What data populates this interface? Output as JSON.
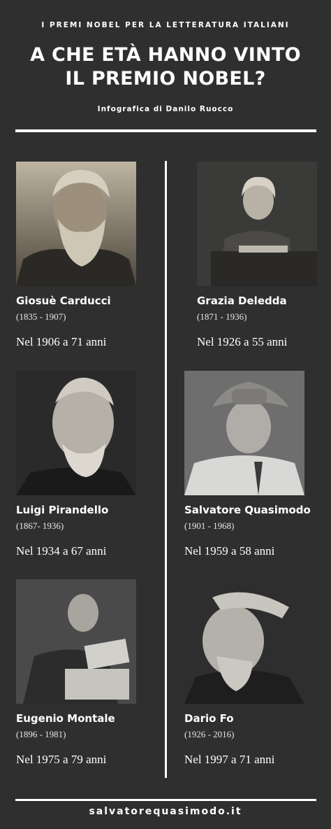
{
  "header": {
    "kicker": "I PREMI NOBEL PER LA LETTERATURA ITALIANI",
    "title_line1": "A CHE ETÀ HANNO VINTO",
    "title_line2": "IL PREMIO NOBEL?",
    "byline": "Infografica di Danilo Ruocco"
  },
  "laureates": [
    {
      "name": "Giosuè Carducci",
      "dates": "(1835 - 1907)",
      "prize": "Nel 1906 a 71 anni"
    },
    {
      "name": "Grazia Deledda",
      "dates": "(1871 - 1936)",
      "prize": "Nel 1926 a 55 anni"
    },
    {
      "name": "Luigi Pirandello",
      "dates": "(1867- 1936)",
      "prize": "Nel 1934 a 67 anni"
    },
    {
      "name": "Salvatore Quasimodo",
      "dates": "(1901 - 1968)",
      "prize": "Nel 1959 a 58 anni"
    },
    {
      "name": "Eugenio Montale",
      "dates": "(1896 - 1981)",
      "prize": "Nel 1975 a 79 anni"
    },
    {
      "name": "Dario Fo",
      "dates": "(1926 - 2016)",
      "prize": "Nel 1997 a 71 anni"
    }
  ],
  "footer": {
    "site": "salvatorequasimodo.it"
  }
}
